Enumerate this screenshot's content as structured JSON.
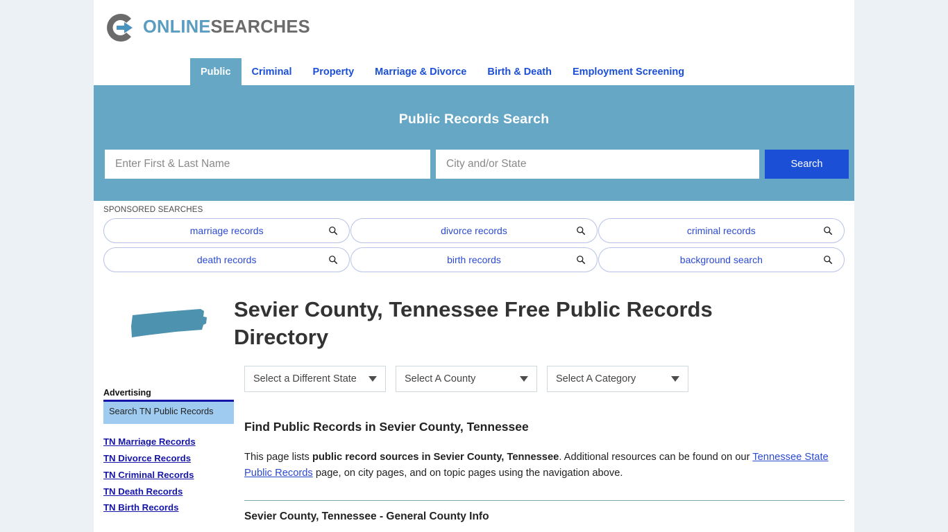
{
  "brand": {
    "logo_icon": "circular-arrow-icon",
    "name_part1": "ONLINE",
    "name_part2": "SEARCHES",
    "color_blue": "#5b9dc0",
    "color_gray": "#6b6b6b"
  },
  "nav": {
    "items": [
      {
        "label": "Public",
        "active": true
      },
      {
        "label": "Criminal",
        "active": false
      },
      {
        "label": "Property",
        "active": false
      },
      {
        "label": "Marriage & Divorce",
        "active": false
      },
      {
        "label": "Birth & Death",
        "active": false
      },
      {
        "label": "Employment Screening",
        "active": false
      }
    ],
    "accent_color": "#66a7c5",
    "link_color": "#1a4fd6"
  },
  "search": {
    "title": "Public Records Search",
    "name_placeholder": "Enter First & Last Name",
    "name_value": "",
    "city_placeholder": "City and/or State",
    "city_value": "",
    "button_label": "Search",
    "button_color": "#1a4fd6",
    "banner_color": "#66a7c5"
  },
  "sponsored": {
    "label": "SPONSORED SEARCHES",
    "row1": [
      {
        "label": "marriage records",
        "icon": "search-icon"
      },
      {
        "label": "divorce records",
        "icon": "search-icon"
      },
      {
        "label": "criminal records",
        "icon": "search-icon"
      }
    ],
    "row2": [
      {
        "label": "death records",
        "icon": "search-icon"
      },
      {
        "label": "birth records",
        "icon": "search-icon"
      },
      {
        "label": "background search",
        "icon": "search-icon"
      }
    ]
  },
  "hero": {
    "state_icon": "tennessee-state-shape-icon",
    "state_icon_color": "#4d93b0",
    "title": "Sevier County, Tennessee Free Public Records Directory"
  },
  "filters": {
    "state": {
      "value": "Select a Different State"
    },
    "county": {
      "value": "Select A County"
    },
    "category": {
      "value": "Select A Category"
    }
  },
  "main": {
    "section_heading": "Find Public Records in Sevier County, Tennessee",
    "paragraph": {
      "part1": "This page lists ",
      "bold1": "public record sources in Sevier County, Tennessee",
      "part2": ". Additional resources can be found on our ",
      "link": "Tennessee State Public Records",
      "part3": " page, on city pages, and on topic pages using the navigation above."
    },
    "subsection_heading": "Sevier County, Tennessee - General County Info"
  },
  "sidebar": {
    "advertising_label": "Advertising",
    "ad_box": {
      "text": "Search TN Public Records"
    },
    "links": [
      {
        "label": "TN Marriage Records"
      },
      {
        "label": "TN Divorce Records"
      },
      {
        "label": "TN Criminal Records"
      },
      {
        "label": "TN Death Records"
      },
      {
        "label": "TN Birth Records"
      }
    ]
  }
}
